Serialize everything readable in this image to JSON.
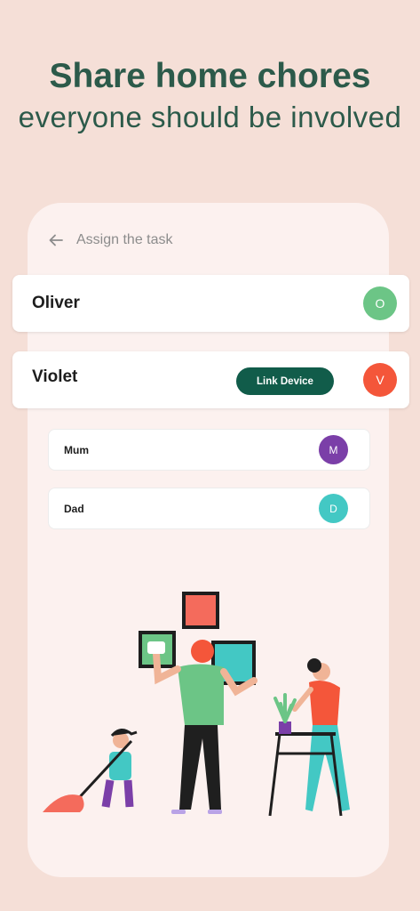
{
  "headline": {
    "title": "Share home chores",
    "subtitle": "everyone should be involved"
  },
  "screen": {
    "title": "Assign the task",
    "back_icon": "arrow-left-icon"
  },
  "members": [
    {
      "name": "Oliver",
      "initial": "O",
      "color": "#6cc586"
    },
    {
      "name": "Violet",
      "initial": "V",
      "color": "#f4563a",
      "action_label": "Link Device"
    },
    {
      "name": "Mum",
      "initial": "M",
      "color": "#7b3fa8"
    },
    {
      "name": "Dad",
      "initial": "D",
      "color": "#43c8c4"
    }
  ],
  "colors": {
    "background": "#f5dfd7",
    "headline": "#2c5a4a",
    "button": "#115c4a"
  },
  "illustration": "family-cleaning-illustration"
}
